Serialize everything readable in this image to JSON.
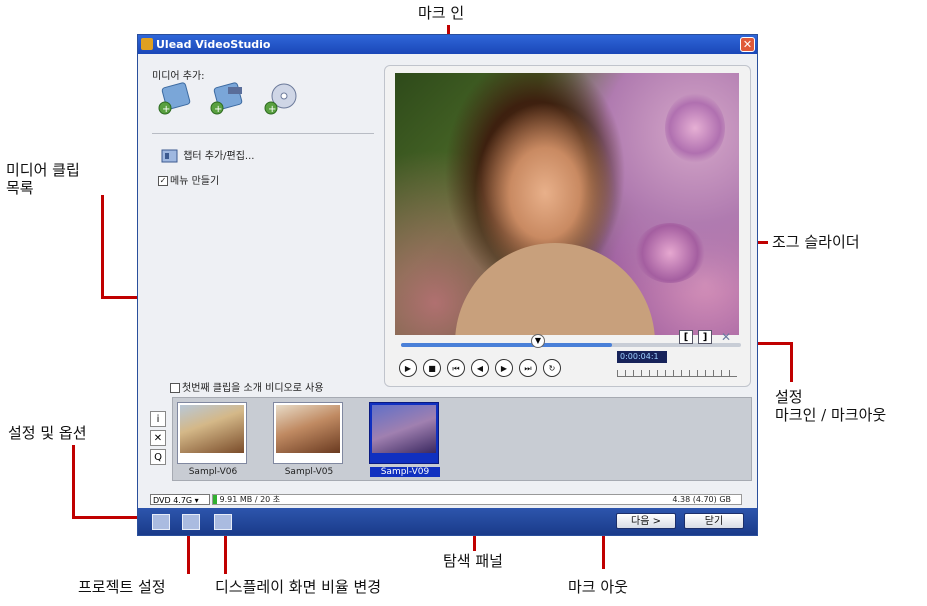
{
  "annotations": {
    "mark_in": "마크 인",
    "media_clip_list": "미디어 클립\n목록",
    "jog_slider": "조그 슬라이더",
    "settings_mark": "설정\n마크인 / 마크아웃",
    "settings_options": "설정 및 옵션",
    "nav_panel": "탐색 패널",
    "project_settings": "프로젝트 설정",
    "display_aspect": "디스플레이 화면 비율 변경",
    "mark_out": "마크 아웃"
  },
  "window": {
    "title": "Ulead VideoStudio",
    "close_glyph": "✕"
  },
  "left_panel": {
    "add_media_label": "미디어 추가:",
    "chapter_label": "챕터 추가/편집...",
    "menu_check_label": "메뉴 만들기",
    "menu_checked": true,
    "intro_check_label": "첫번째 클립을 소개 비디오로 사용",
    "intro_checked": false
  },
  "preview": {
    "timecode": "0:00:04:1",
    "progress": 0.62,
    "jog_position": 0.4,
    "nav_glyphs": [
      "▶",
      "■",
      "⏮",
      "◀",
      "▶",
      "⏭",
      "↻"
    ],
    "mark_in_glyph": "[",
    "mark_out_glyph": "]",
    "cancel_glyph": "✕"
  },
  "clips": [
    {
      "name": "Sampl-V06",
      "selected": false
    },
    {
      "name": "Sampl-V05",
      "selected": false
    },
    {
      "name": "Sampl-V09",
      "selected": true
    }
  ],
  "side_buttons": [
    "i",
    "✕",
    "Q"
  ],
  "status": {
    "disc": "DVD 4.7G",
    "used": "9.91 MB / 20 초",
    "capacity": "4.38 (4.70) GB"
  },
  "buttons": {
    "next": "다음 >",
    "close": "닫기"
  }
}
